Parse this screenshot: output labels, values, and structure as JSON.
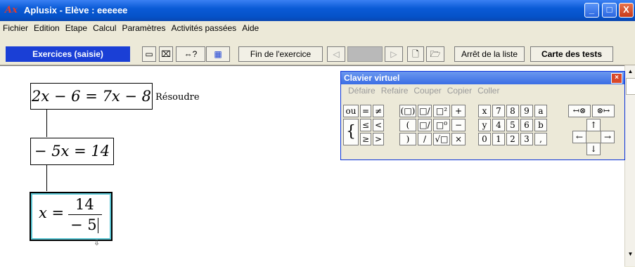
{
  "window": {
    "logo": "Ax",
    "title": "Aplusix - Elève  : eeeeee",
    "buttons": {
      "minimize": "_",
      "maximize": "□",
      "close": "X"
    }
  },
  "menu": [
    "Fichier",
    "Edition",
    "Etape",
    "Calcul",
    "Paramètres",
    "Activités passées",
    "Aide"
  ],
  "toolbar": {
    "mode": "Exercices (saisie)",
    "icon_single": "▭",
    "icon_cross": "⌧",
    "icon_equiv": "⇔?",
    "icon_keyboard": "▦",
    "end_exercise": "Fin de l'exercice",
    "prev": "◁",
    "next": "▷",
    "new_doc": "🗋",
    "open_folder": "🗁",
    "stop_list": "Arrêt de la liste",
    "tests_map": "Carte des tests"
  },
  "workspace": {
    "eq1": "2x − 6 = 7x − 8",
    "eq1_label": "Résoudre",
    "eq2": "− 5x = 14",
    "eq3_lhs": "x =",
    "eq3_num": "14",
    "eq3_den": "− 5"
  },
  "keyboard": {
    "title": "Clavier virtuel",
    "close": "×",
    "menu": [
      "Défaire",
      "Refaire",
      "Couper",
      "Copier",
      "Coller"
    ],
    "row1": [
      "ou",
      "=",
      "≠",
      "(□)",
      "□/□",
      "□²",
      "+",
      "x",
      "7",
      "8",
      "9",
      "a"
    ],
    "row2": [
      "≤",
      "<",
      "(",
      "□/□",
      "□⁰",
      "−",
      "y",
      "4",
      "5",
      "6",
      "b"
    ],
    "row3": [
      "≥",
      ">",
      ")",
      "/",
      "√□",
      "×",
      "0",
      "1",
      "2",
      "3",
      ","
    ],
    "brace": "{",
    "nav_left": "↤⊗",
    "nav_right": "⊗↦",
    "arrows": {
      "up": "↑",
      "left": "←",
      "right": "→",
      "down": "↓"
    }
  }
}
